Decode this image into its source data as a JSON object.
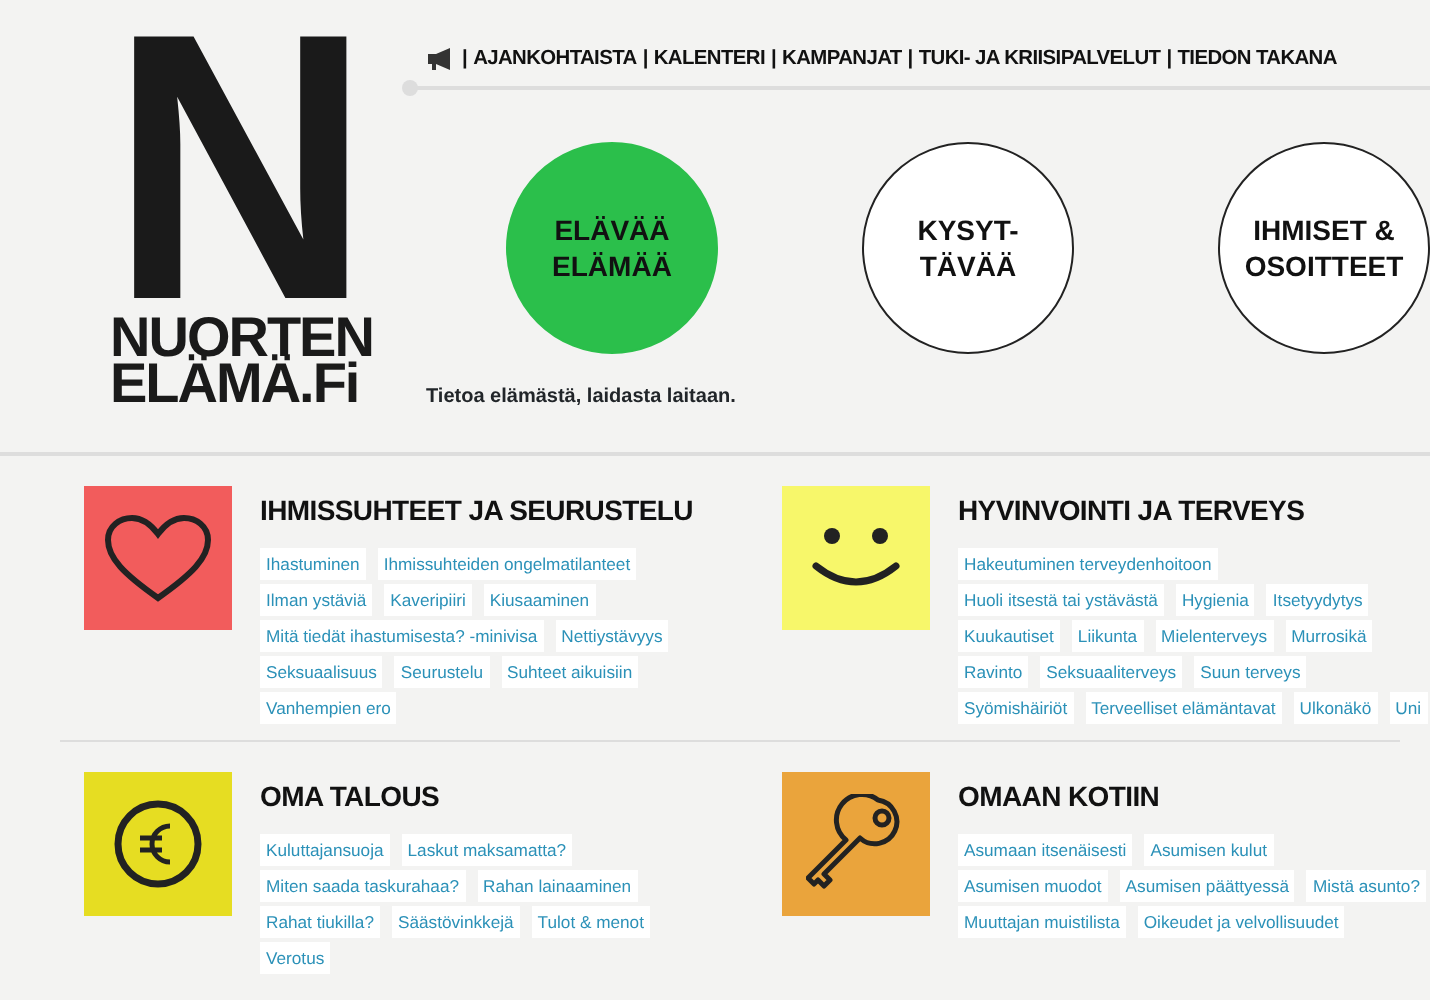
{
  "logo": {
    "letter": "N",
    "lines": [
      "NUORTEN",
      "ELÄMÄ.Fi"
    ]
  },
  "nav": {
    "separator": "|",
    "items": [
      "AJANKOHTAISTA",
      "KALENTERI",
      "KAMPANJAT",
      "TUKI- JA KRIISIPALVELUT",
      "TIEDON TAKANA"
    ]
  },
  "circles": [
    {
      "lines": [
        "ELÄVÄÄ",
        "ELÄMÄÄ"
      ],
      "selected": true
    },
    {
      "lines": [
        "KYSYT-",
        "TÄVÄÄ"
      ],
      "selected": false
    },
    {
      "lines": [
        "IHMISET &",
        "OSOITTEET"
      ],
      "selected": false
    }
  ],
  "tagline": "Tietoa elämästä, laidasta laitaan.",
  "sections": [
    {
      "title": "IHMISSUHTEET JA SEURUSTELU",
      "kind": "heart",
      "color": "#f25c5c",
      "tags": [
        "Ihastuminen",
        "Ihmissuhteiden ongelmatilanteet",
        "Ilman ystäviä",
        "Kaveripiiri",
        "Kiusaaminen",
        "Mitä tiedät ihastumisesta? -minivisa",
        "Nettiystävyys",
        "Seksuaalisuus",
        "Seurustelu",
        "Suhteet aikuisiin",
        "Vanhempien ero"
      ]
    },
    {
      "title": "HYVINVOINTI JA TERVEYS",
      "kind": "smile",
      "color": "#f7f76a",
      "tags": [
        "Hakeutuminen terveydenhoitoon",
        "Huoli itsestä tai ystävästä",
        "Hygienia",
        "Itsetyydytys",
        "Kuukautiset",
        "Liikunta",
        "Mielenterveys",
        "Murrosikä",
        "Ravinto",
        "Seksuaaliterveys",
        "Suun terveys",
        "Syömishäiriöt",
        "Terveelliset elämäntavat",
        "Ulkonäkö",
        "Uni"
      ]
    },
    {
      "title": "OMA TALOUS",
      "kind": "euro",
      "color": "#e6dd22",
      "tags": [
        "Kuluttajansuoja",
        "Laskut maksamatta?",
        "Miten saada taskurahaa?",
        "Rahan lainaaminen",
        "Rahat tiukilla?",
        "Säästövinkkejä",
        "Tulot & menot",
        "Verotus"
      ]
    },
    {
      "title": "OMAAN KOTIIN",
      "kind": "key",
      "color": "#eaa43c",
      "tags": [
        "Asumaan itsenäisesti",
        "Asumisen kulut",
        "Asumisen muodot",
        "Asumisen päättyessä",
        "Mistä asunto?",
        "Muuttajan muistilista",
        "Oikeudet ja velvollisuudet"
      ]
    }
  ]
}
